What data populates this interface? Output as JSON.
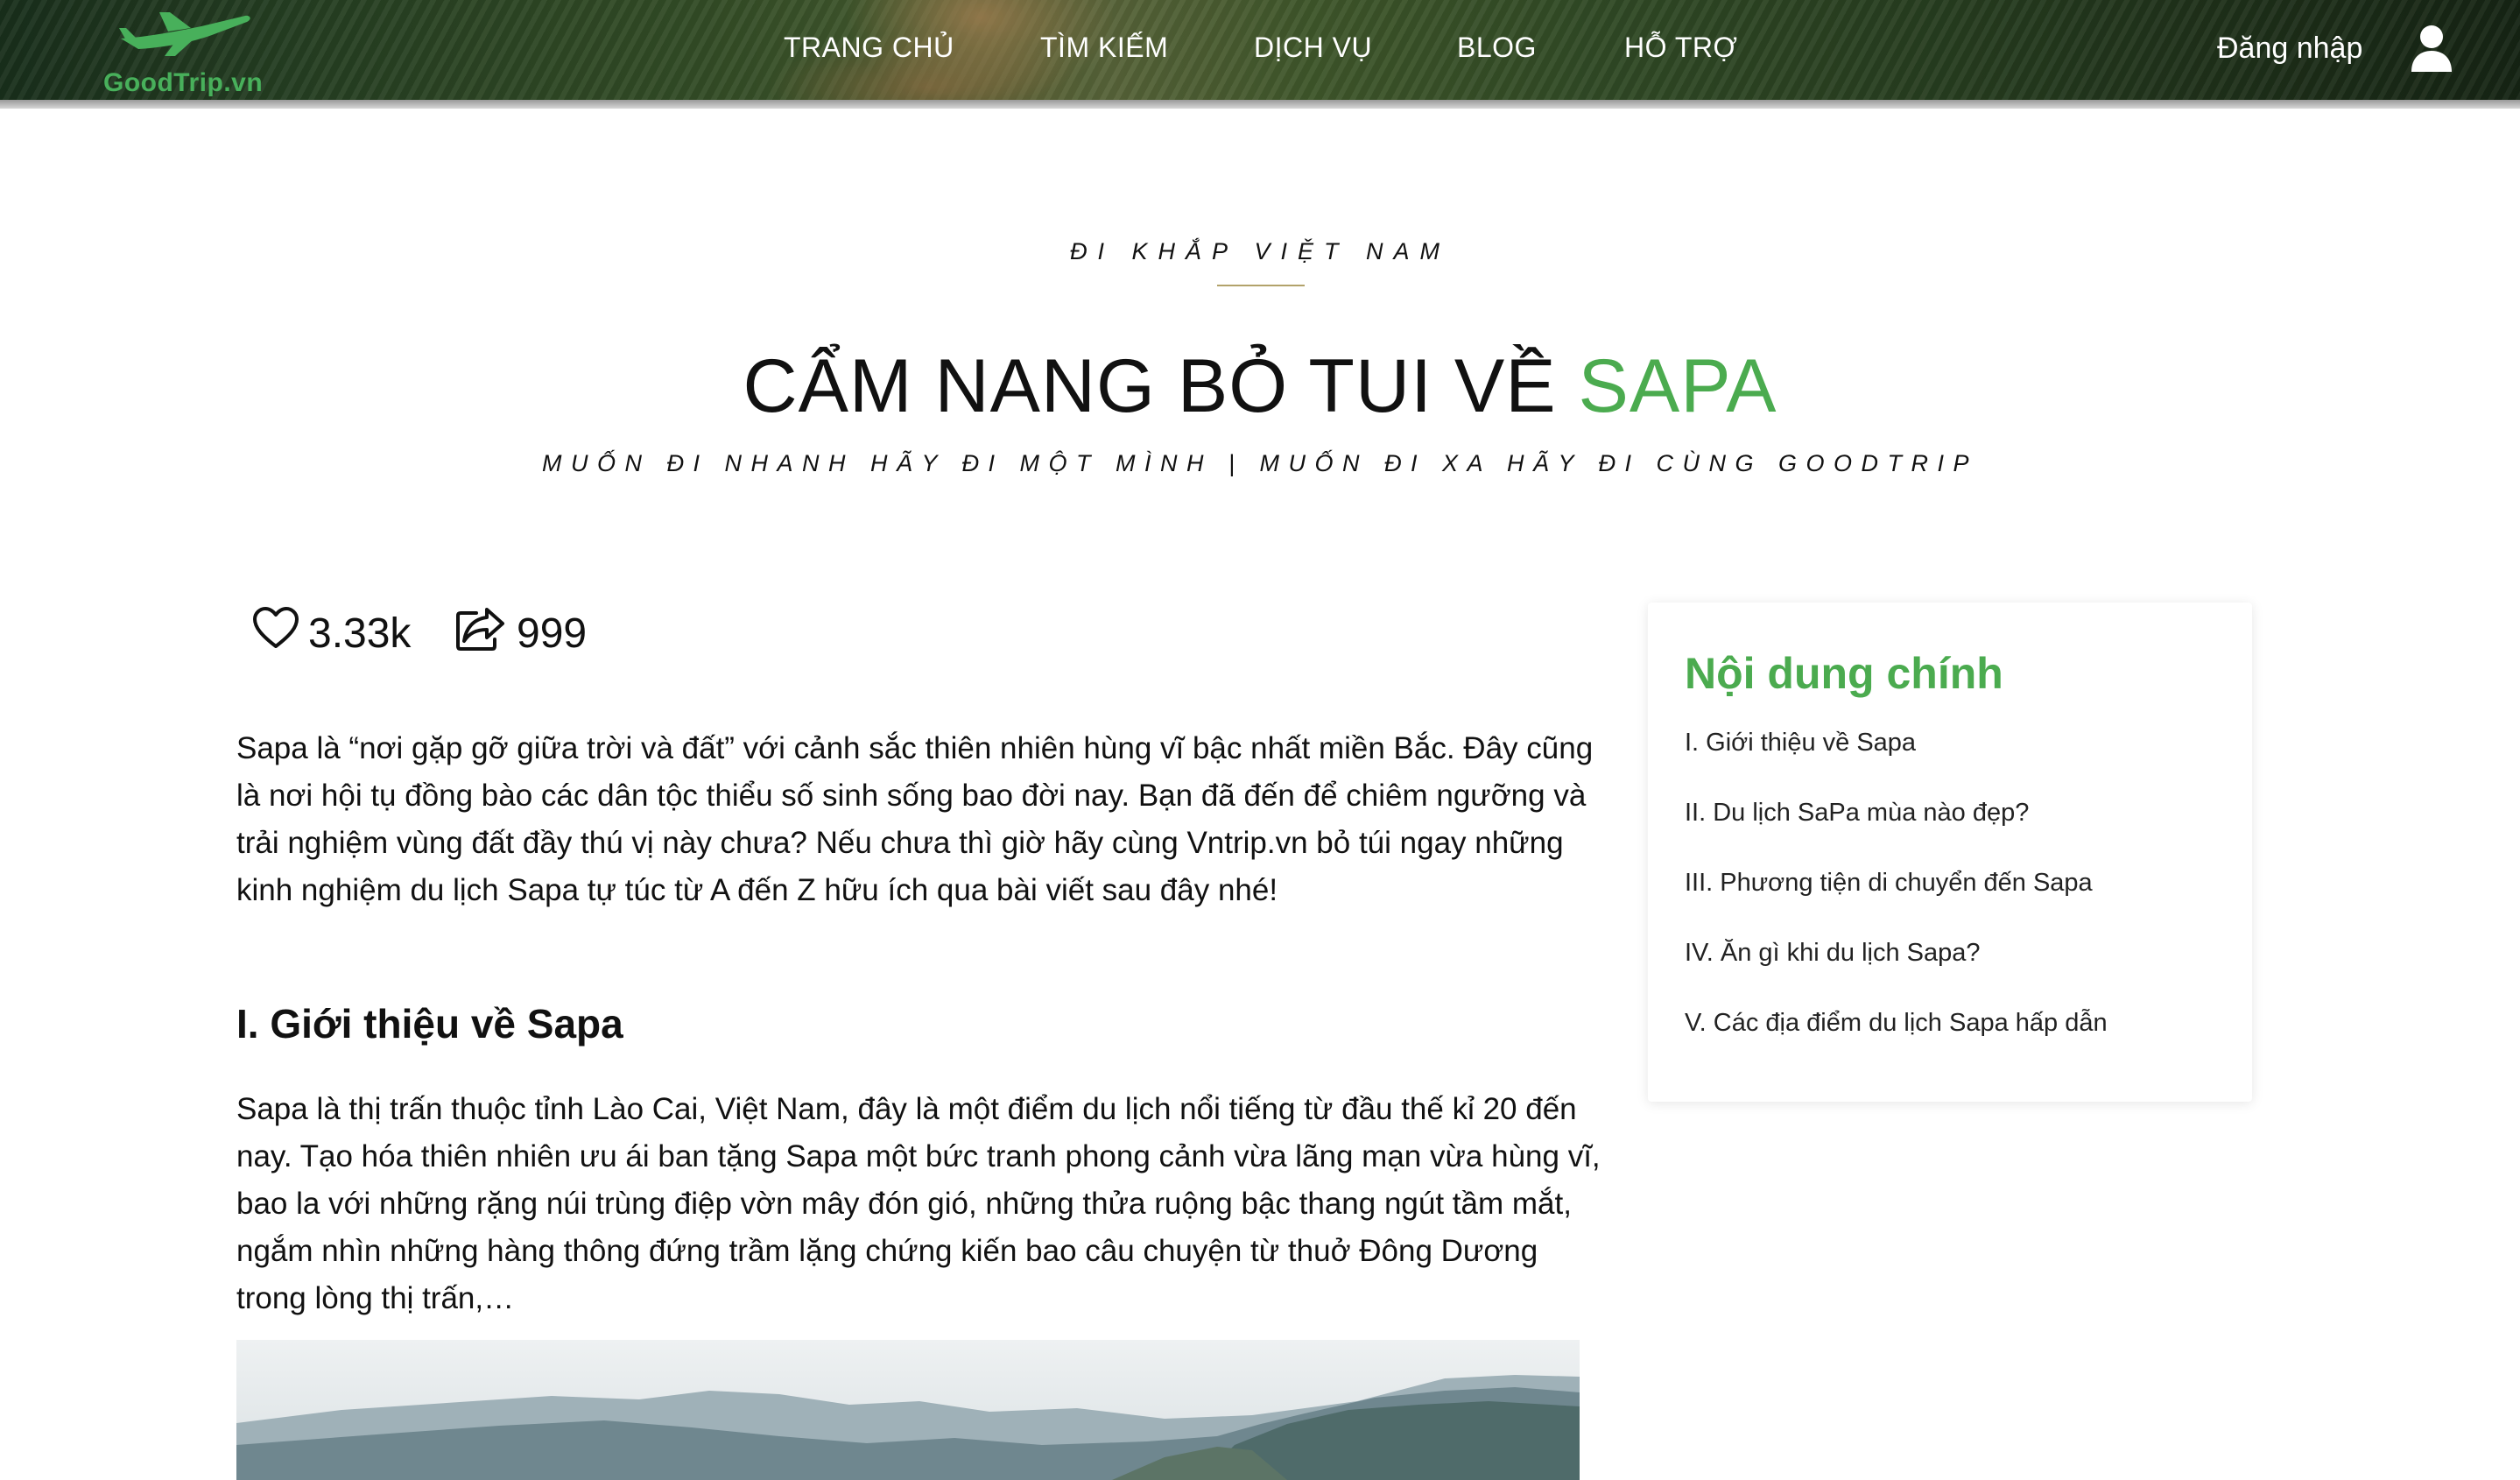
{
  "header": {
    "logo_text": "GoodTrip.vn",
    "nav": [
      "TRANG CHỦ",
      "TÌM KIẾM",
      "DỊCH VỤ",
      "BLOG",
      "HỖ TRỢ"
    ],
    "login_label": "Đăng nhập",
    "user_icon": "user-icon"
  },
  "hero": {
    "kicker": "ĐI KHẮP VIỆT NAM",
    "title_main": "CẨM NANG BỎ TUI VỀ ",
    "title_accent": "SAPA",
    "tagline": "MUỐN ĐI NHANH HÃY ĐI MỘT MÌNH | MUỐN ĐI XA HÃY ĐI CÙNG GOODTRIP"
  },
  "stats": {
    "likes": "3.33k",
    "likes_icon": "heart-icon",
    "shares": "999",
    "shares_icon": "share-icon"
  },
  "article": {
    "intro": "Sapa là “nơi gặp gỡ giữa trời và đất” với cảnh sắc thiên nhiên hùng vĩ bậc nhất miền Bắc. Đây cũng là nơi hội tụ đồng bào các dân tộc thiểu số sinh sống bao đời nay. Bạn đã đến để chiêm ngưỡng và trải nghiệm vùng đất đầy thú vị này chưa? Nếu chưa thì giờ hãy cùng Vntrip.vn bỏ túi ngay những kinh nghiệm du lịch Sapa tự túc từ A đến Z hữu ích qua bài viết sau đây nhé!",
    "section1_heading": "I. Giới thiệu về Sapa",
    "section1_text": "Sapa là thị trấn thuộc tỉnh Lào Cai, Việt Nam, đây là một điểm du lịch nổi tiếng từ đầu thế kỉ 20 đến nay. Tạo hóa thiên nhiên ưu ái ban tặng Sapa một bức tranh phong cảnh vừa lãng mạn vừa hùng vĩ, bao la với những rặng núi trùng điệp vờn mây đón gió, những thửa ruộng bậc thang ngút tầm mắt, ngắm nhìn những hàng thông đứng trầm lặng chứng kiến bao câu chuyện từ thuở Đông Dương trong lòng thị trấn,…"
  },
  "toc": {
    "title": "Nội dung chính",
    "items": [
      "I. Giới thiệu về Sapa",
      "II. Du lịch SaPa mùa nào đẹp?",
      "III. Phương tiện di chuyển đến Sapa",
      "IV. Ăn gì khi du lịch Sapa?",
      "V. Các địa điểm du lịch Sapa hấp dẫn"
    ]
  },
  "colors": {
    "accent_green": "#4bab4f",
    "logo_green": "#48b05b",
    "kicker_rule": "#b2a26a"
  }
}
